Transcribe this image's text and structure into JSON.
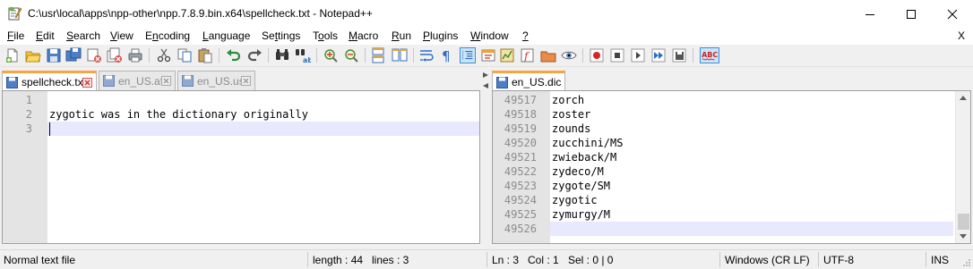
{
  "window": {
    "title": "C:\\usr\\local\\apps\\npp-other\\npp.7.8.9.bin.x64\\spellcheck.txt - Notepad++",
    "minimize_icon": "minimize-icon",
    "maximize_icon": "maximize-icon",
    "close_icon": "close-icon"
  },
  "menu": {
    "items": [
      "File",
      "Edit",
      "Search",
      "View",
      "Encoding",
      "Language",
      "Settings",
      "Tools",
      "Macro",
      "Run",
      "Plugins",
      "Window",
      "?"
    ],
    "mnemonics": [
      "F",
      "E",
      "S",
      "V",
      "n",
      "L",
      "t",
      "o",
      "M",
      "R",
      "P",
      "W",
      "?"
    ],
    "close_doc": "X"
  },
  "toolbar": {
    "icons": [
      "new-file-icon",
      "open-file-icon",
      "save-icon",
      "save-all-icon",
      "close-icon",
      "close-all-icon",
      "print-icon",
      "cut-icon",
      "copy-icon",
      "paste-icon",
      "undo-icon",
      "redo-icon",
      "find-icon",
      "replace-icon",
      "zoom-in-icon",
      "zoom-out-icon",
      "sync-vertical-icon",
      "sync-horizontal-icon",
      "word-wrap-icon",
      "show-all-characters-icon",
      "indent-guide-icon",
      "udl-icon",
      "document-map-icon",
      "function-list-icon",
      "folder-as-workspace-icon",
      "monitoring-icon",
      "record-macro-icon",
      "stop-macro-icon",
      "play-macro-icon",
      "run-macro-multiple-icon",
      "save-macro-icon",
      "spellcheck-abc-icon"
    ]
  },
  "left_pane": {
    "tabs": [
      {
        "label": "spellcheck.txt",
        "active": true
      },
      {
        "label": "en_US.aff",
        "active": false
      },
      {
        "label": "en_US.usr",
        "active": false
      }
    ],
    "lines": [
      {
        "number": "1",
        "text": ""
      },
      {
        "number": "2",
        "text": "zygotic was in the dictionary originally"
      },
      {
        "number": "3",
        "text": ""
      }
    ],
    "current_line": 3
  },
  "right_pane": {
    "tabs": [
      {
        "label": "en_US.dic",
        "active": true
      }
    ],
    "lines": [
      {
        "number": "49517",
        "text": "zorch"
      },
      {
        "number": "49518",
        "text": "zoster"
      },
      {
        "number": "49519",
        "text": "zounds"
      },
      {
        "number": "49520",
        "text": "zucchini/MS"
      },
      {
        "number": "49521",
        "text": "zwieback/M"
      },
      {
        "number": "49522",
        "text": "zydeco/M"
      },
      {
        "number": "49523",
        "text": "zygote/SM"
      },
      {
        "number": "49524",
        "text": "zygotic"
      },
      {
        "number": "49525",
        "text": "zymurgy/M"
      },
      {
        "number": "49526",
        "text": ""
      }
    ],
    "current_line": 49526,
    "scroll_position": 0.99
  },
  "status": {
    "file_type": "Normal text file",
    "length": "length : 44",
    "lines": "lines : 3",
    "ln": "Ln : 3",
    "col": "Col : 1",
    "sel": "Sel : 0 | 0",
    "eol": "Windows (CR LF)",
    "encoding": "UTF-8",
    "mode": "INS"
  },
  "colors": {
    "current_line": "#e8e8ff",
    "active_tab_accent": "#f9a342",
    "gutter": "#e4e4e4",
    "line_number": "#8c8c8c"
  }
}
